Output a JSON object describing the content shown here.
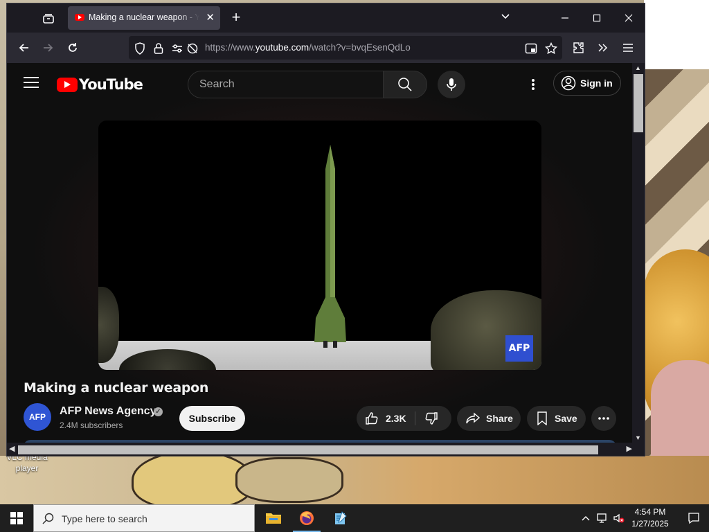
{
  "desktop": {
    "icon_label": "VLC media player"
  },
  "browser": {
    "tab": {
      "title": "Making a nuclear weapon - YouTube"
    },
    "url": {
      "prefix": "https://www.",
      "domain": "youtube.com",
      "path": "/watch?v=bvqEsenQdLo"
    }
  },
  "youtube": {
    "logo_text": "YouTube",
    "search_placeholder": "Search",
    "sign_in_label": "Sign in",
    "video": {
      "watermark": "AFP",
      "title": "Making a nuclear weapon"
    },
    "channel": {
      "avatar_text": "AFP",
      "name": "AFP News Agency",
      "subscribers": "2.4M subscribers"
    },
    "subscribe_label": "Subscribe",
    "likes": "2.3K",
    "share_label": "Share",
    "save_label": "Save"
  },
  "taskbar": {
    "search_placeholder": "Type here to search",
    "time": "4:54 PM",
    "date": "1/27/2025"
  },
  "colors": {
    "brand_red": "#ff0000",
    "afp_blue": "#2f4fd0",
    "browser_dark": "#1c1b22",
    "yt_background": "#0f0f0f"
  }
}
